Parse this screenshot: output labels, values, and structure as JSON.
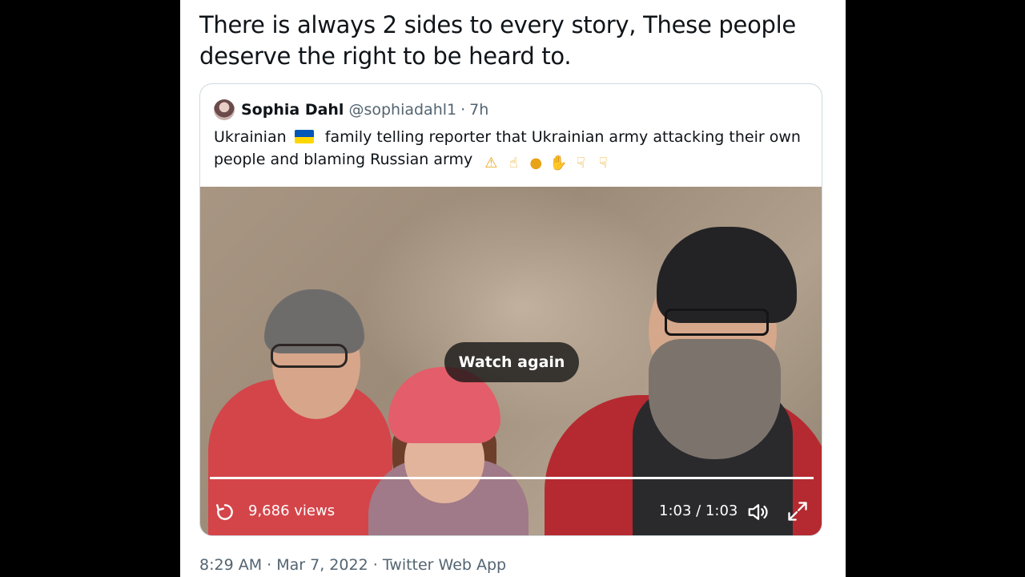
{
  "tweet": {
    "text": "There is always 2 sides to every story, These people deserve the right to be heard to."
  },
  "quote": {
    "name": "Sophia Dahl",
    "handle": "@sophiadahl1",
    "separator": "·",
    "time": "7h",
    "text_before_flag": "Ukrainian",
    "text_after_flag": "family telling reporter that Ukrainian army attacking their own people and blaming Russian army",
    "flag_colors": {
      "top": "#0057b7",
      "bottom": "#ffd700"
    },
    "emojis": [
      "warning-emoji",
      "pointing-up-emoji",
      "thinking-emoji",
      "folded-hands-emoji",
      "pointing-down-emoji",
      "pointing-down-emoji"
    ]
  },
  "video": {
    "overlay_label": "Watch again",
    "views": "9,686 views",
    "time": "1:03 / 1:03",
    "progress": 1.0,
    "icons": {
      "replay": "replay-icon",
      "volume": "volume-icon",
      "fullscreen": "fullscreen-icon"
    }
  },
  "meta": {
    "time": "8:29 AM",
    "date": "Mar 7, 2022",
    "source": "Twitter Web App",
    "separator": "·"
  }
}
